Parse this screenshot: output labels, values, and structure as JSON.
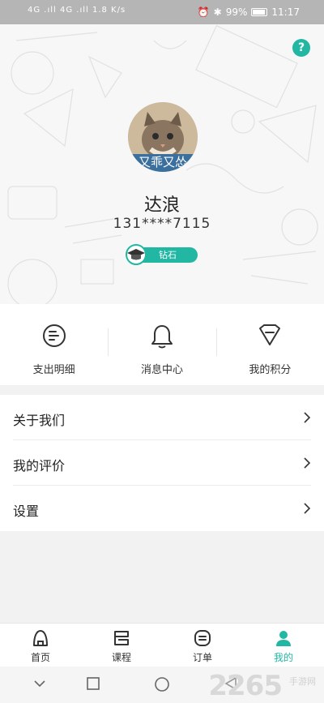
{
  "status_bar": {
    "signal_text": "4G .ıll 4G .ıll  1.8 K/s",
    "battery_percent": "99%",
    "time": "11:17"
  },
  "header": {
    "help_label": "?",
    "avatar_caption": "又乖又怂",
    "user_name": "达浪",
    "phone": "131****7115",
    "level_label": "钻石"
  },
  "quick_actions": [
    {
      "label": "支出明细",
      "icon": "receipt-list-icon"
    },
    {
      "label": "消息中心",
      "icon": "bell-icon"
    },
    {
      "label": "我的积分",
      "icon": "diamond-points-icon"
    }
  ],
  "menu": [
    {
      "label": "关于我们"
    },
    {
      "label": "我的评价"
    },
    {
      "label": "设置"
    }
  ],
  "tabbar": {
    "tabs": [
      {
        "label": "首页",
        "icon": "home-icon",
        "active": false
      },
      {
        "label": "课程",
        "icon": "course-icon",
        "active": false
      },
      {
        "label": "订单",
        "icon": "order-icon",
        "active": false
      },
      {
        "label": "我的",
        "icon": "profile-icon",
        "active": true
      }
    ]
  },
  "watermark": {
    "text": "2265",
    "sub": "手游网"
  },
  "colors": {
    "accent": "#22b7a3",
    "status_bar": "#b5b5b5"
  }
}
